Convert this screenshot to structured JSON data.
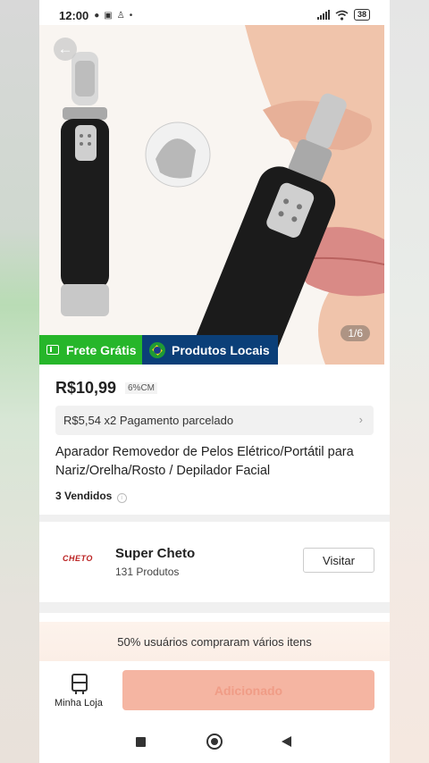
{
  "status_bar": {
    "time": "12:00",
    "battery": "38"
  },
  "gallery": {
    "counter": "1/6"
  },
  "badges": {
    "frete": "Frete Grátis",
    "locais": "Produtos Locais"
  },
  "product": {
    "price": "R$10,99",
    "cm_badge": "6%CM",
    "installment": "R$5,54 x2 Pagamento parcelado",
    "title": "Aparador Removedor de Pelos Elétrico/Portátil para Nariz/Orelha/Rosto / Depilador Facial",
    "sold": "3 Vendidos"
  },
  "shop": {
    "logo_text": "CHETO",
    "name": "Super Cheto",
    "products": "131 Produtos",
    "visit_label": "Visitar"
  },
  "promo": {
    "text": "50% usuários compraram vários itens"
  },
  "bottom_bar": {
    "store_label": "Minha Loja",
    "add_label": "Adicionado"
  },
  "colors": {
    "green": "#26b62a",
    "navy": "#0b3f78",
    "add_button": "#f5b5a2"
  }
}
